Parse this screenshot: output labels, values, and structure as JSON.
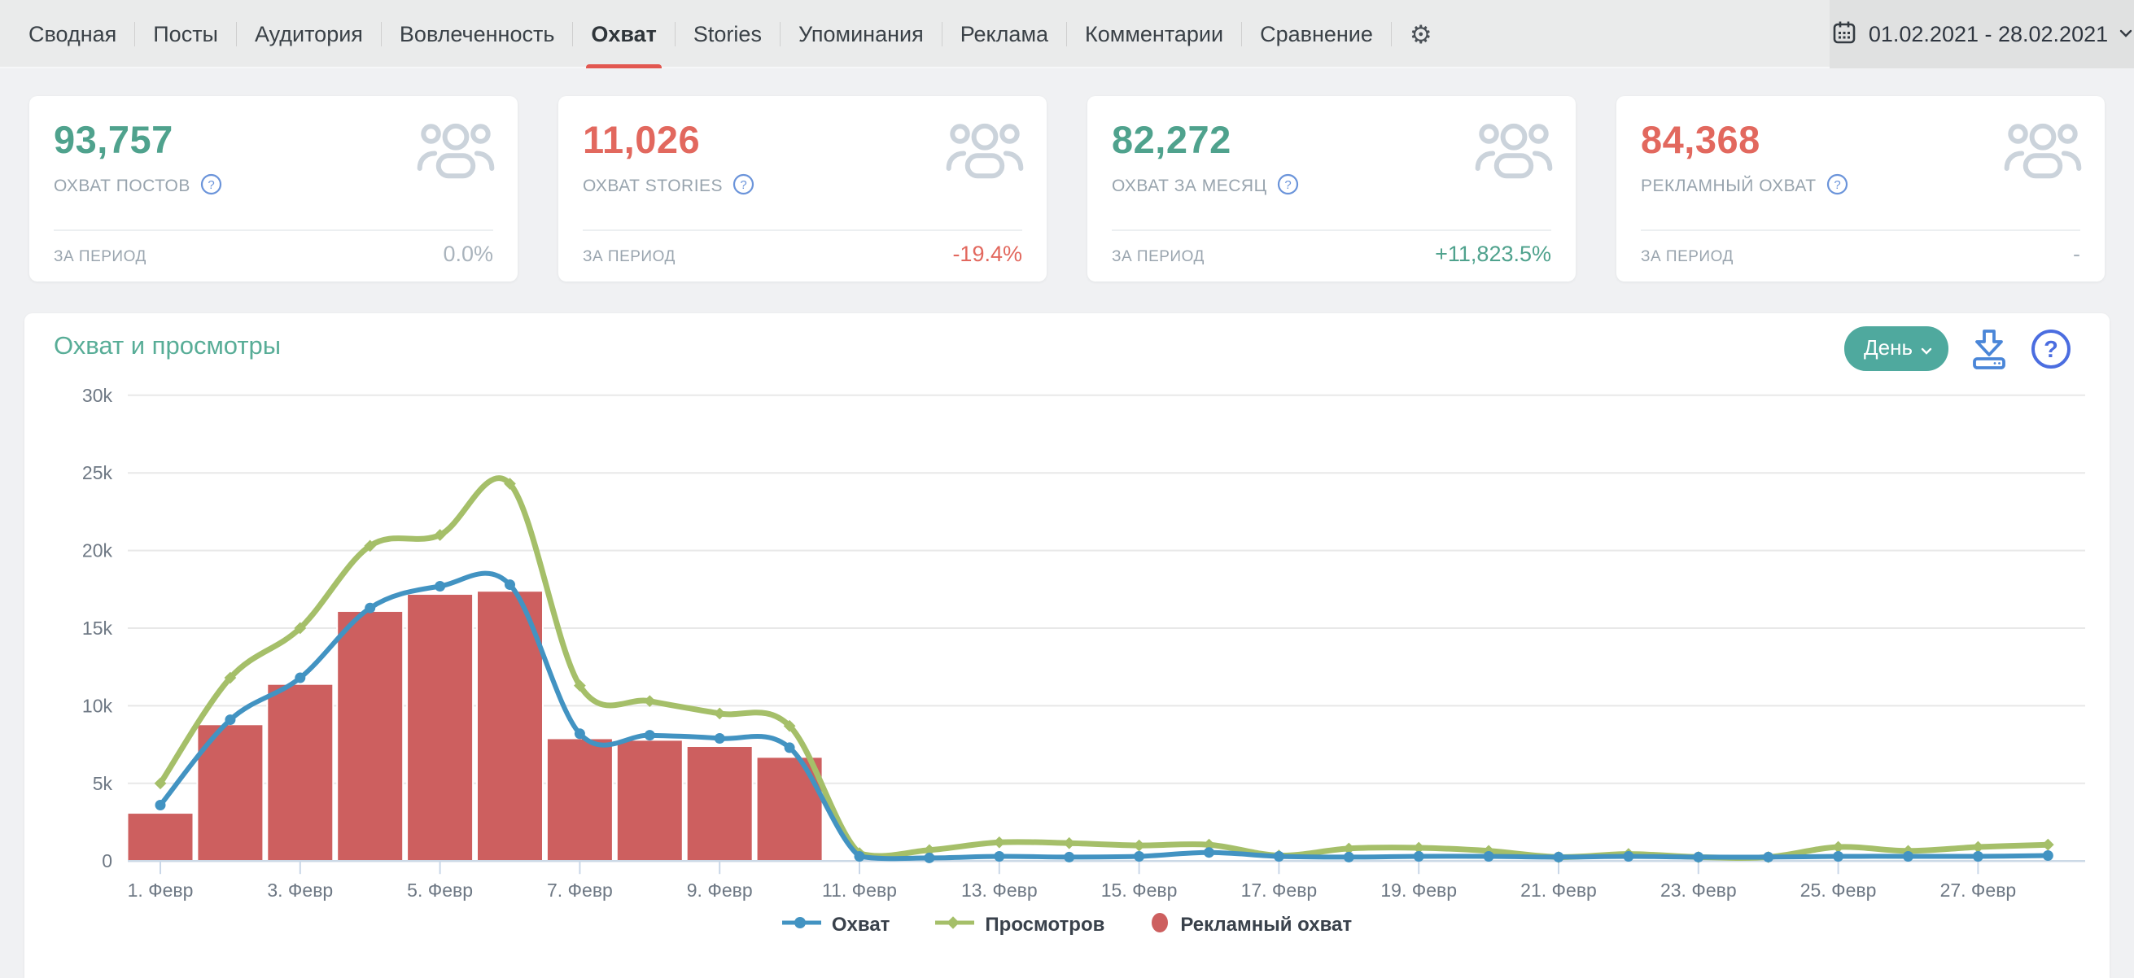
{
  "nav": {
    "tabs": [
      {
        "id": "summary",
        "label": "Сводная",
        "active": false
      },
      {
        "id": "posts",
        "label": "Посты",
        "active": false
      },
      {
        "id": "audience",
        "label": "Аудитория",
        "active": false
      },
      {
        "id": "engagement",
        "label": "Вовлеченность",
        "active": false
      },
      {
        "id": "reach",
        "label": "Охват",
        "active": true
      },
      {
        "id": "stories",
        "label": "Stories",
        "active": false
      },
      {
        "id": "mentions",
        "label": "Упоминания",
        "active": false
      },
      {
        "id": "ads",
        "label": "Реклама",
        "active": false
      },
      {
        "id": "comments",
        "label": "Комментарии",
        "active": false
      },
      {
        "id": "compare",
        "label": "Сравнение",
        "active": false
      }
    ],
    "date_range": "01.02.2021 - 28.02.2021"
  },
  "cards": [
    {
      "id": "posts-reach",
      "value": "93,757",
      "value_color": "#4fa28d",
      "label": "ОХВАТ ПОСТОВ",
      "period_label": "ЗА ПЕРИОД",
      "delta": "0.0%",
      "delta_color": "#aab4bd"
    },
    {
      "id": "stories-reach",
      "value": "11,026",
      "value_color": "#e2685e",
      "label": "ОХВАТ STORIES",
      "period_label": "ЗА ПЕРИОД",
      "delta": "-19.4%",
      "delta_color": "#e2685e"
    },
    {
      "id": "month-reach",
      "value": "82,272",
      "value_color": "#4fa28d",
      "label": "ОХВАТ ЗА МЕСЯЦ",
      "period_label": "ЗА ПЕРИОД",
      "delta": "+11,823.5%",
      "delta_color": "#4fa28d"
    },
    {
      "id": "ad-reach",
      "value": "84,368",
      "value_color": "#e2685e",
      "label": "РЕКЛАМНЫЙ ОХВАТ",
      "period_label": "ЗА ПЕРИОД",
      "delta": "-",
      "delta_color": "#aab4bd"
    }
  ],
  "chart": {
    "title": "Охват и просмотры",
    "interval_button": "День"
  },
  "chart_data": {
    "type": "combo",
    "title": "Охват и просмотры",
    "categories": [
      1,
      2,
      3,
      4,
      5,
      6,
      7,
      8,
      9,
      10,
      11,
      12,
      13,
      14,
      15,
      16,
      17,
      18,
      19,
      20,
      21,
      22,
      23,
      24,
      25,
      26,
      27,
      28
    ],
    "month_label": "Февр",
    "x_tick_labels": [
      "1. Февр",
      "3. Февр",
      "5. Февр",
      "7. Февр",
      "9. Февр",
      "11. Февр",
      "13. Февр",
      "15. Февр",
      "17. Февр",
      "19. Февр",
      "21. Февр",
      "23. Февр",
      "25. Февр",
      "27. Февр"
    ],
    "ylim": [
      0,
      30000
    ],
    "yticks": [
      0,
      5000,
      10000,
      15000,
      20000,
      25000,
      30000
    ],
    "ytick_labels": [
      "0",
      "5k",
      "10k",
      "15k",
      "20k",
      "25k",
      "30k"
    ],
    "grid": true,
    "legend_position": "bottom",
    "series": [
      {
        "name": "Охват",
        "kind": "line",
        "marker": "circle",
        "color": "#4293c2",
        "values": [
          3600,
          9100,
          11800,
          16300,
          17700,
          17800,
          8200,
          8100,
          7900,
          7300,
          300,
          200,
          300,
          250,
          300,
          550,
          300,
          250,
          300,
          300,
          250,
          300,
          250,
          250,
          300,
          300,
          300,
          350
        ]
      },
      {
        "name": "Просмотров",
        "kind": "line",
        "marker": "diamond",
        "color": "#a5bf69",
        "values": [
          5000,
          11800,
          15000,
          20300,
          21000,
          24300,
          11300,
          10300,
          9500,
          8700,
          500,
          700,
          1200,
          1150,
          1000,
          1050,
          350,
          800,
          850,
          650,
          250,
          450,
          250,
          250,
          900,
          650,
          900,
          1050
        ]
      },
      {
        "name": "Рекламный охват",
        "kind": "bar",
        "marker": "ellipse",
        "color": "#cd5f5f",
        "values": [
          3100,
          8800,
          11400,
          16100,
          17200,
          17400,
          7900,
          7800,
          7400,
          6700,
          0,
          0,
          0,
          0,
          0,
          0,
          0,
          0,
          0,
          0,
          0,
          0,
          0,
          0,
          0,
          0,
          0,
          0
        ]
      }
    ]
  }
}
